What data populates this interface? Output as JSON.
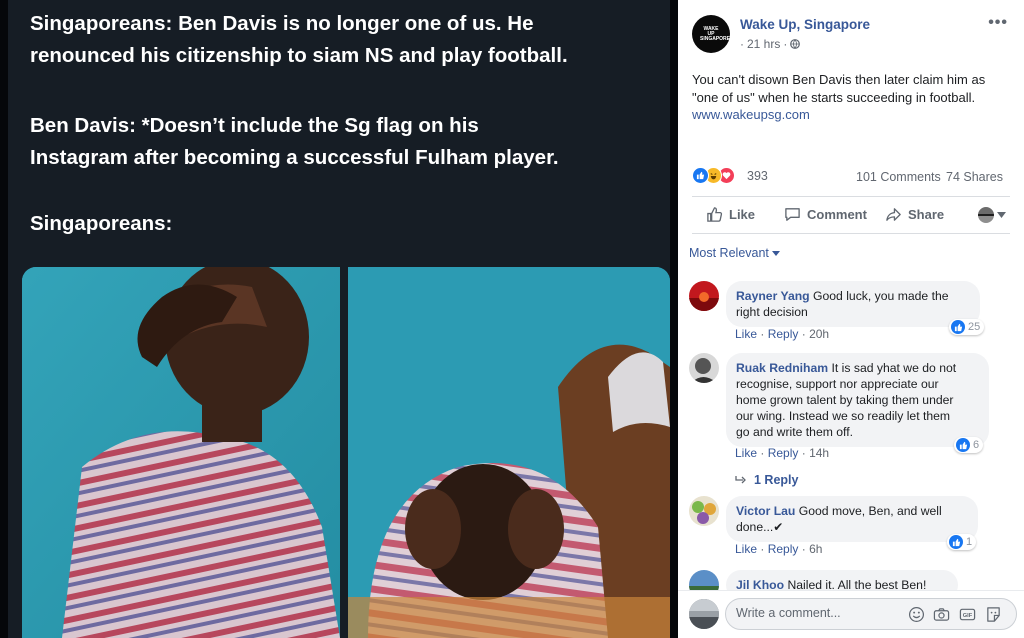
{
  "meme": {
    "lines": [
      "Singaporeans: Ben Davis is no longer one of us. He",
      "renounced his citizenship to siam NS and play football.",
      "Ben Davis: *Doesn’t include the Sg flag on his",
      "Instagram after becoming a successful Fulham player.",
      "Singaporeans:"
    ]
  },
  "post": {
    "page_name": "Wake Up, Singapore",
    "avatar_text": "WAKE UP SINGAPORE",
    "time": "21 hrs",
    "time_separator": "·",
    "more_icon": "•••",
    "text": "You can't disown Ben Davis then later claim him as \"one of us\" when he starts succeeding in football.",
    "link": "www.wakeupsg.com",
    "reactions": {
      "icons": [
        "like-icon",
        "haha-icon",
        "love-icon"
      ],
      "count": "393",
      "comments": "101 Comments",
      "shares": "74 Shares"
    },
    "actions": {
      "like": "Like",
      "comment": "Comment",
      "share": "Share"
    }
  },
  "comments_section": {
    "sort_label": "Most Relevant",
    "comments": [
      {
        "name": "Rayner Yang",
        "text_line1": "Good luck, you made the",
        "text_line2": "right decision",
        "like_action": "Like",
        "reply_action": "Reply",
        "time": "20h",
        "likes": "25"
      },
      {
        "name": "Ruak Redniham",
        "text_line1": "It is sad yhat we do not",
        "text_line2": "recognise, support nor appreciate our",
        "text_line3": "home grown talent by taking them under",
        "text_line4": "our wing. Instead we so readily let them",
        "text_line5": "go and write them off.",
        "like_action": "Like",
        "reply_action": "Reply",
        "time": "14h",
        "likes": "6",
        "replies": "1 Reply"
      },
      {
        "name": "Victor Lau",
        "text_line1": "Good move, Ben, and well",
        "text_line2": "done...✔",
        "like_action": "Like",
        "reply_action": "Reply",
        "time": "6h",
        "likes": "1"
      },
      {
        "name": "Jil Khoo",
        "text_line1": "Nailed it. All the best Ben!"
      }
    ],
    "separator": "·"
  },
  "composer": {
    "placeholder": "Write a comment..."
  },
  "colors": {
    "link_blue": "#385898",
    "like_blue": "#1877f2",
    "meme_bg": "#161d25"
  }
}
